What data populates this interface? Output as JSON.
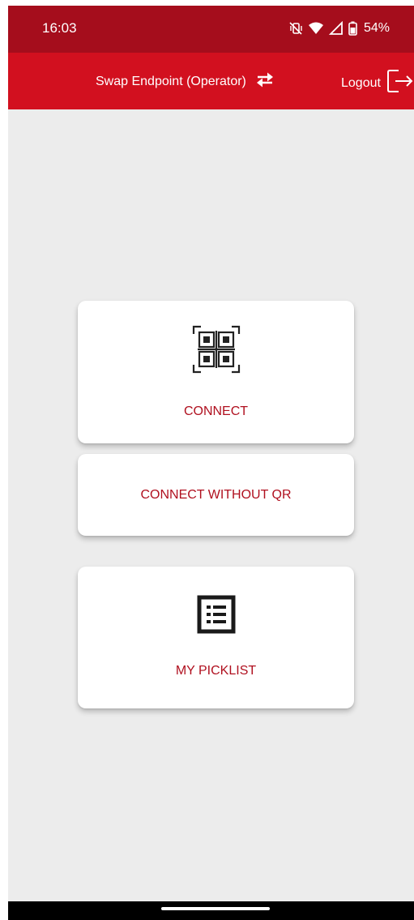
{
  "status_bar": {
    "time": "16:03",
    "battery": "54%",
    "icons": [
      "mute-vibrate-icon",
      "wifi-icon",
      "cellular-signal-icon",
      "battery-icon"
    ]
  },
  "app_bar": {
    "swap_label": "Swap Endpoint (Operator)",
    "swap_icon": "swap-arrows-icon",
    "logout_label": "Logout",
    "logout_icon": "logout-icon"
  },
  "cards": {
    "connect": {
      "label": "CONNECT",
      "icon": "qr-code-scan-icon"
    },
    "connect_without_qr": {
      "label": "CONNECT WITHOUT QR"
    },
    "picklist": {
      "label": "MY PICKLIST",
      "icon": "list-icon"
    }
  },
  "colors": {
    "status_bar": "#a50d1c",
    "app_bar": "#d2101f",
    "accent_text": "#b0101f",
    "background": "#ececec"
  }
}
